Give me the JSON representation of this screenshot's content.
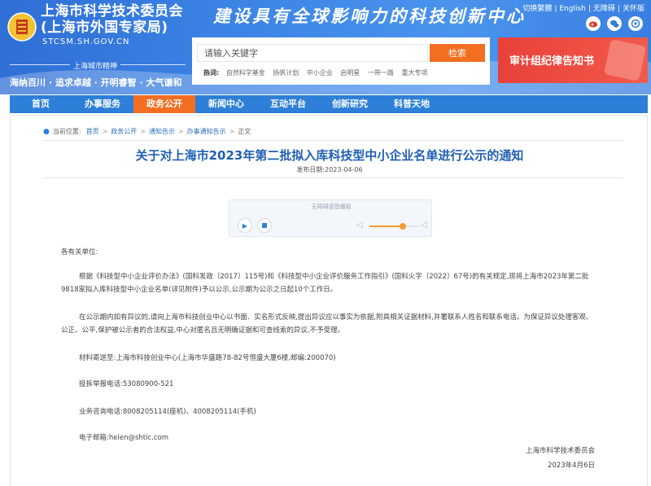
{
  "header": {
    "title_line1": "上海市科学技术委员会",
    "title_line2": "(上海市外国专家局)",
    "domain": "STCSM.SH.GOV.CN",
    "spirit_label": "上海城市精神",
    "spirit_text": "海纳百川 · 追求卓越 · 开明睿智 · 大气谦和",
    "slogan": "建设具有全球影响力的科技创新中心",
    "top_links": [
      "切换繁體",
      "English",
      "无障碍",
      "关怀版"
    ]
  },
  "search": {
    "placeholder": "请输入关键字",
    "button_label": "检索",
    "hot_label": "热词:",
    "hot_keywords": [
      "自然科学基金",
      "扬帆计划",
      "中小企业",
      "启明星",
      "一带一路",
      "重大专项"
    ]
  },
  "banner": {
    "text": "审计组纪律告知书"
  },
  "nav": {
    "items": [
      "首页",
      "办事服务",
      "政务公开",
      "新闻中心",
      "互动平台",
      "创新研究",
      "科普天地"
    ],
    "active_index": 2
  },
  "breadcrumb": {
    "prefix": "当前位置:",
    "items": [
      "首页",
      "政务公开",
      "通知告示",
      "办事通知告示",
      "正文"
    ]
  },
  "article": {
    "title": "关于对上海市2023年第二批拟入库科技型中小企业名单进行公示的通知",
    "publish_date": "发布日期:2023-04-06",
    "player_label": "无障碍语音播报",
    "volume_level": 0.68,
    "salutation": "各有关单位:",
    "para1": "根据《科技型中小企业评价办法》(国科发政〔2017〕115号)和《科技型中小企业评价服务工作指引》(国科火字〔2022〕67号)的有关规定,现将上海市2023年第二批9818家拟入库科技型中小企业名单(详见附件)予以公示,公示期为公示之日起10个工作日。",
    "para2": "在公示期内如有异议的,请向上海市科技创业中心以书面、实名形式反映,提出异议应以事实为依据,附具相关证据材料,并署联系人姓名和联系电话。为保证异议处理客观、公正、公平,保护被公示者的合法权益,中心对匿名且无明确证据和可查线索的异议,不予受理。",
    "mail_address": "材料寄送至:上海市科技创业中心(上海市华盛路78-82号恒盛大厦6楼,邮编:200070)",
    "report_tel": "投拆举报电话:53080900-521",
    "biz_tel": "业务咨询电话:8008205114(座机)、4008205114(手机)",
    "email": "电子邮箱:helen@shtic.com",
    "sign_org": "上海市科学技术委员会",
    "sign_date": "2023年4月6日"
  }
}
